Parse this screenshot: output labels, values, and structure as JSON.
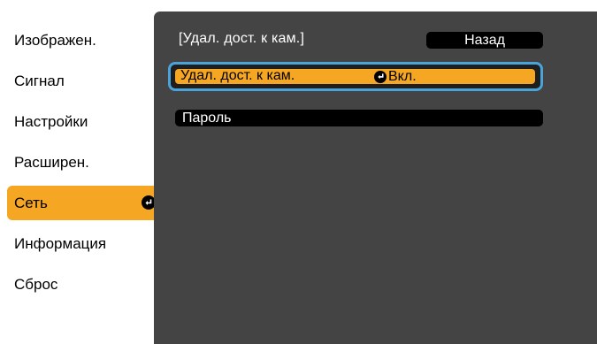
{
  "sidebar": {
    "items": [
      {
        "label": "Изображен."
      },
      {
        "label": "Сигнал"
      },
      {
        "label": "Настройки"
      },
      {
        "label": "Расширен."
      },
      {
        "label": "Сеть"
      },
      {
        "label": "Информация"
      },
      {
        "label": "Сброс"
      }
    ],
    "active_index": 4
  },
  "panel": {
    "title": "[Удал. дост. к кам.]",
    "back_label": "Назад",
    "rows": [
      {
        "label": "Удал. дост. к кам.",
        "value": "Вкл.",
        "selected": true
      },
      {
        "label": "Пароль"
      }
    ]
  },
  "colors": {
    "accent": "#f5a623",
    "panel_bg": "#444444",
    "selection_border": "#4aa3d9"
  },
  "icons": {
    "enter": "enter-icon"
  }
}
